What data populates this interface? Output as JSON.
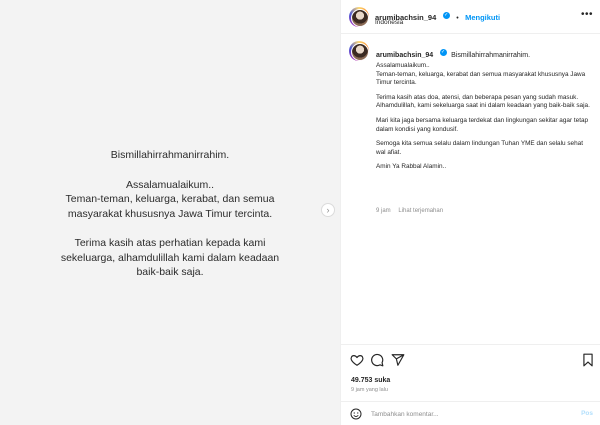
{
  "media": {
    "lines_block1": [
      "Bismillahirrahmanirrahim."
    ],
    "lines_block2": [
      "Assalamualaikum..",
      "Teman-teman, keluarga, kerabat, dan semua",
      "masyarakat khususnya Jawa Timur tercinta."
    ],
    "lines_block3": [
      "Terima kasih atas perhatian kepada kami",
      "sekeluarga, alhamdulillah kami dalam keadaan",
      "baik-baik saja."
    ],
    "next_icon": "chevron-right-icon"
  },
  "header": {
    "username": "arumibachsin_94",
    "follow_label": "Mengikuti",
    "location": "Indonesia"
  },
  "caption": {
    "username": "arumibachsin_94",
    "first_line": "Bismillahirrahmanirrahim.",
    "p1_a": "Assalamualaikum..",
    "p1_b": "Teman-teman, keluarga, kerabat dan semua masyarakat khususnya Jawa Timur tercinta.",
    "p2": "Terima kasih atas doa, atensi, dan beberapa pesan yang sudah masuk. Alhamdulillah, kami sekeluarga saat ini dalam keadaan yang baik-baik saja.",
    "p3": "Mari kita jaga bersama keluarga terdekat dan lingkungan sekitar agar tetap dalam kondisi yang kondusif.",
    "p4": "Semoga kita semua selalu dalam lindungan Tuhan YME dan selalu sehat wal afiat.",
    "p5": "Amin Ya Rabbal Alamin..",
    "time": "9 jam",
    "translate": "Lihat terjemahan"
  },
  "actions": {
    "likes": "49.753 suka",
    "time_ago": "9 jam yang lalu",
    "comment_placeholder": "Tambahkan komentar...",
    "post_label": "Pos"
  },
  "colors": {
    "accent": "#0095f6",
    "media_bg": "#f3f3f3",
    "muted": "#8e8e8e"
  }
}
